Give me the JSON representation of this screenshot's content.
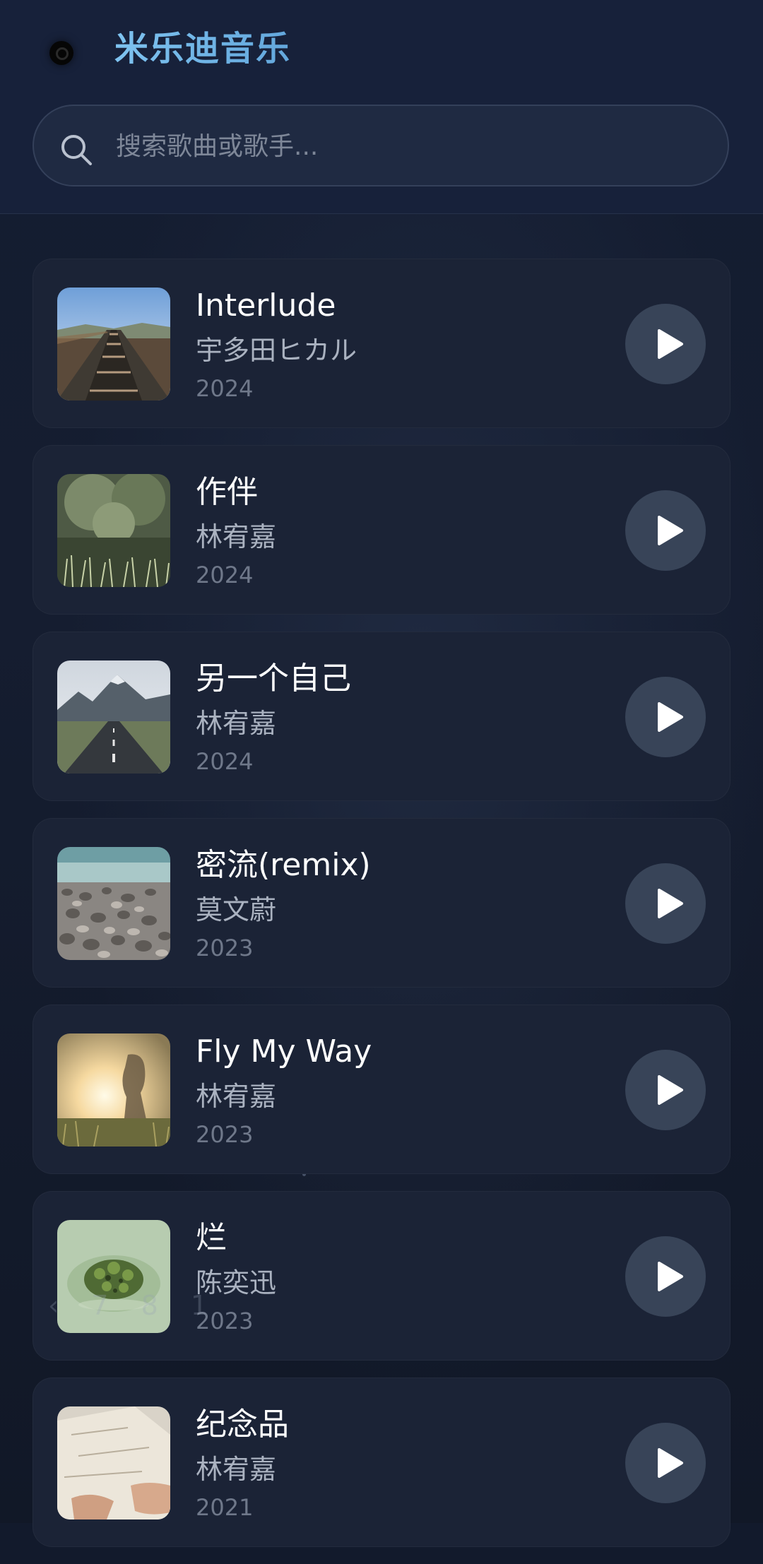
{
  "header": {
    "app_title": "米乐迪音乐",
    "search_placeholder": "搜索歌曲或歌手..."
  },
  "songs": [
    {
      "title": "Interlude",
      "artist": "宇多田ヒカル",
      "year": "2024",
      "cover": "railway"
    },
    {
      "title": "作伴",
      "artist": "林宥嘉",
      "year": "2024",
      "cover": "grass"
    },
    {
      "title": "另一个自己",
      "artist": "林宥嘉",
      "year": "2024",
      "cover": "mountain-road"
    },
    {
      "title": "密流(remix)",
      "artist": "莫文蔚",
      "year": "2023",
      "cover": "pebbles"
    },
    {
      "title": "Fly My Way",
      "artist": "林宥嘉",
      "year": "2023",
      "cover": "sunset-girl"
    },
    {
      "title": "烂",
      "artist": "陈奕迅",
      "year": "2023",
      "cover": "moss"
    },
    {
      "title": "纪念品",
      "artist": "林宥嘉",
      "year": "2021",
      "cover": "paper-hands"
    }
  ],
  "pager": {
    "prev": "‹",
    "pages": [
      "7",
      "8",
      "1"
    ]
  },
  "colors": {
    "accent": "#6cb4e8",
    "background": "#121a2c",
    "card": "#1b2336",
    "play_button": "#384458"
  },
  "icons": {
    "search": "search-icon",
    "play": "play-icon",
    "logo": "vinyl-logo-icon"
  }
}
